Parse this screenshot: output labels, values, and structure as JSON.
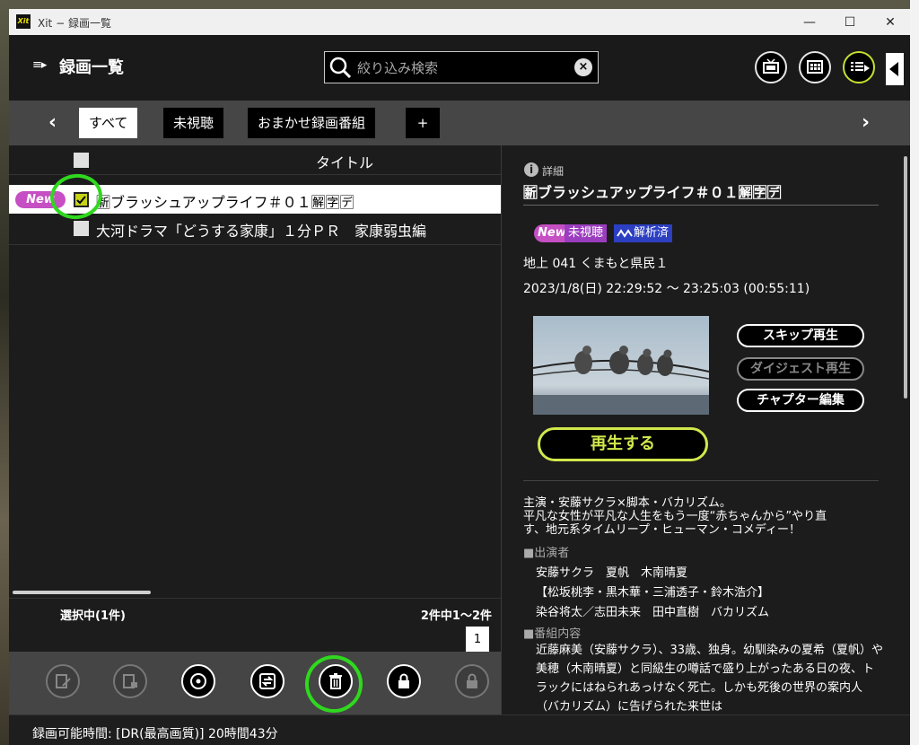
{
  "window": {
    "title": "Xit − 録画一覧",
    "app_icon": "Xit",
    "minimize": "—",
    "maximize": "☐",
    "close": "✕"
  },
  "header": {
    "title": "録画一覧",
    "search": {
      "placeholder": "絞り込み検索",
      "value": ""
    }
  },
  "tabs": [
    "すべて",
    "未視聴",
    "おまかせ録画番組",
    "+"
  ],
  "list": {
    "column_title": "タイトル",
    "rows": [
      {
        "badge": "New",
        "title": "🈟ブラッシュアップライフ＃０１🈖🈑🈓",
        "checked": true,
        "selected": true
      },
      {
        "badge": "",
        "title": "大河ドラマ「どうする家康」１分ＰＲ　家康弱虫編",
        "checked": false,
        "selected": false
      }
    ],
    "selection_status": "選択中(1件)",
    "range_status": "2件中1〜2件",
    "page": "1"
  },
  "detail": {
    "section_label": "詳細",
    "title": "🈟ブラッシュアップライフ＃０１🈖🈑🈓",
    "badges": {
      "new": "New",
      "unwatched": "未視聴",
      "analyzed": "解析済"
    },
    "channel": "地上 041 くまもと県民１",
    "datetime": "2023/1/8(日) 22:29:52 〜 23:25:03 (00:55:11)",
    "buttons": {
      "skip": "スキップ再生",
      "digest": "ダイジェスト再生",
      "chapter": "チャプター編集",
      "play": "再生する"
    },
    "description": [
      "主演・安藤サクラ×脚本・バカリズム。",
      "平凡な女性が平凡な人生をもう一度“赤ちゃんから”やり直",
      "す、地元系タイムリープ・ヒューマン・コメディー！"
    ],
    "cast_header": "■出演者",
    "cast": [
      "安藤サクラ　夏帆　木南晴夏",
      "【松坂桃李・黒木華・三浦透子・鈴木浩介】",
      "染谷将太／志田未来　田中直樹　バカリズム"
    ],
    "content_header": "■番組内容",
    "content": "近藤麻美（安藤サクラ）、33歳、独身。幼馴染みの夏希（夏帆）や美穂（木南晴夏）と同級生の噂話で盛り上がったある日の夜、トラックにはねられあっけなく死亡。しかも死後の世界の案内人（バカリズム）に告げられた来世は"
  },
  "status_bar": {
    "text": "録画可能時間: [DR(最高画質)] 20時間43分"
  },
  "colors": {
    "accent": "#c7e02e",
    "new_badge": "#c54fc3",
    "unwatched_badge": "#9b3dbf",
    "analyzed_badge": "#2c3fc1",
    "annotation_green": "#2fd81e"
  }
}
